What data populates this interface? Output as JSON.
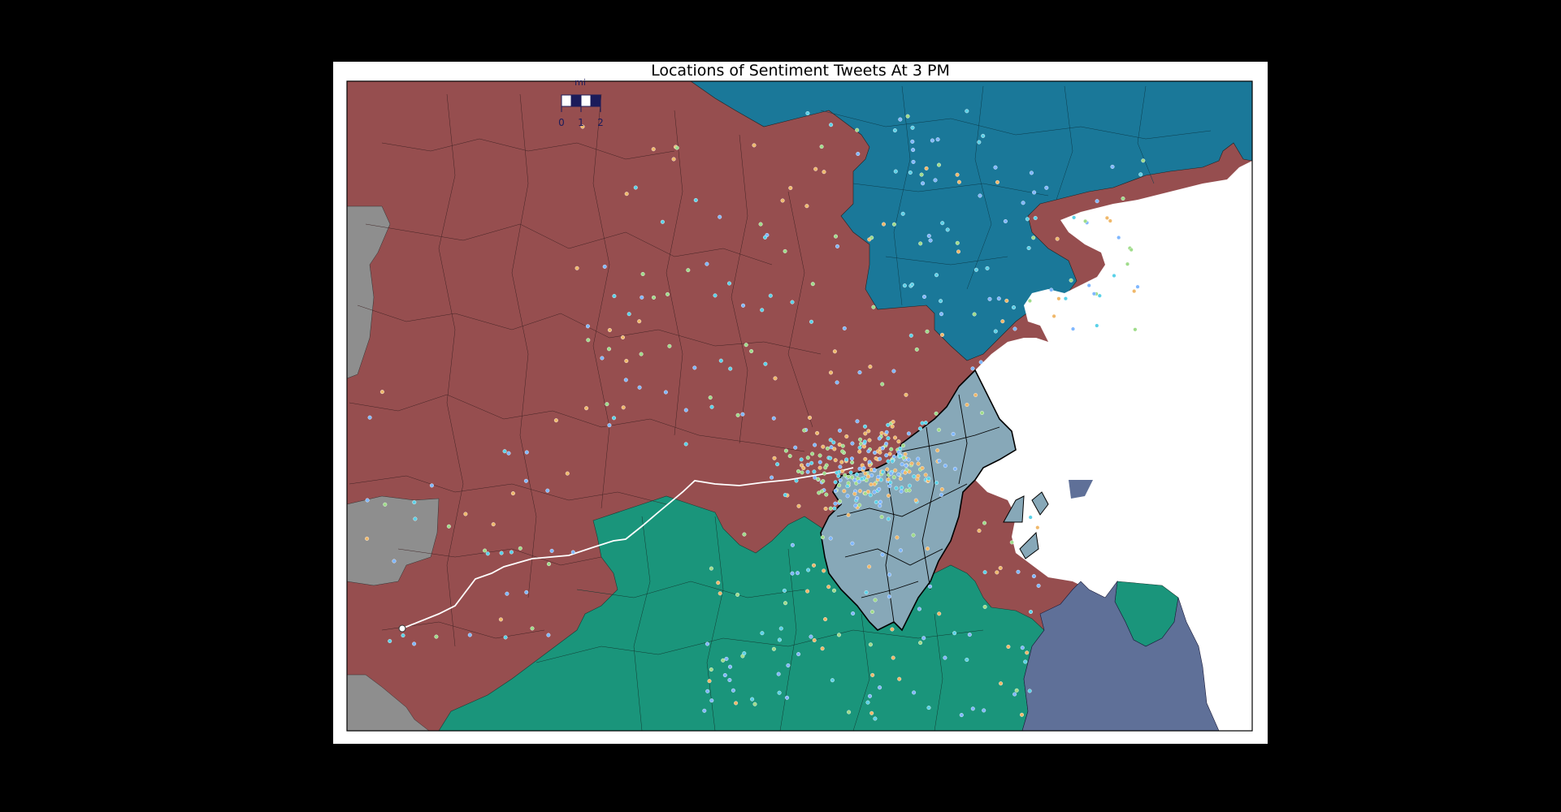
{
  "title": "Locations of Sentiment Tweets At 3 PM",
  "scale_bar": {
    "unit": "mi",
    "ticks": [
      "0",
      "1",
      "2"
    ]
  },
  "colors": {
    "region_red": "#964e4f",
    "region_teal_blue": "#1a7899",
    "region_green": "#1a957b",
    "region_light_blue": "#87a8b8",
    "region_slate": "#5f7098",
    "region_gray": "#8e8e8e",
    "water": "#ffffff",
    "path_line": "#ffffff",
    "scale_dark": "#1b1b5a"
  },
  "map_layers": {
    "regions": [
      "red",
      "teal-blue",
      "green",
      "light-blue",
      "slate",
      "gray"
    ],
    "tweet_marker_colors": [
      "#5ad1e8",
      "#f0b86a",
      "#9fdc8a",
      "#7fb7ff"
    ],
    "path": "white track line with markers"
  }
}
